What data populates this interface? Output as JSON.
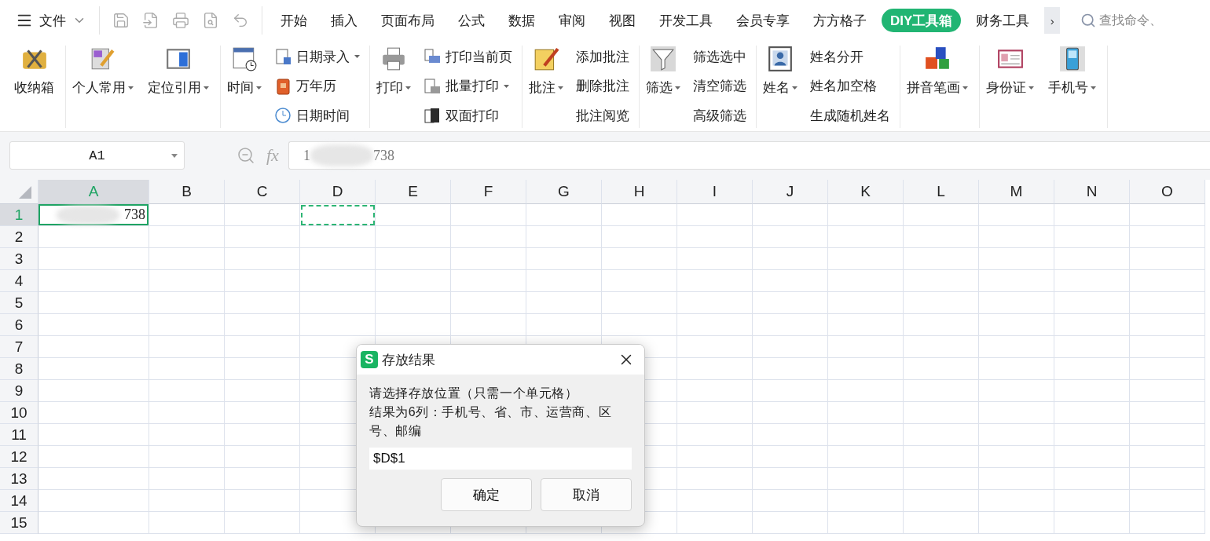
{
  "menu": {
    "file_label": "文件"
  },
  "tabs": [
    {
      "label": "开始",
      "selected": false
    },
    {
      "label": "插入",
      "selected": false
    },
    {
      "label": "页面布局",
      "selected": false
    },
    {
      "label": "公式",
      "selected": false
    },
    {
      "label": "数据",
      "selected": false
    },
    {
      "label": "审阅",
      "selected": false
    },
    {
      "label": "视图",
      "selected": false
    },
    {
      "label": "开发工具",
      "selected": false
    },
    {
      "label": "会员专享",
      "selected": false
    },
    {
      "label": "方方格子",
      "selected": false
    },
    {
      "label": "DIY工具箱",
      "selected": true
    },
    {
      "label": "财务工具",
      "selected": false
    }
  ],
  "more_tabs": "›",
  "search": {
    "placeholder": "查找命令、"
  },
  "ribbon": [
    {
      "items": [
        {
          "kind": "large",
          "label": "收纳箱",
          "dropdown": false
        }
      ]
    },
    {
      "items": [
        {
          "kind": "large",
          "label": "个人常用",
          "dropdown": true
        },
        {
          "kind": "large",
          "label": "定位引用",
          "dropdown": true
        }
      ]
    },
    {
      "items": [
        {
          "kind": "large",
          "label": "时间",
          "dropdown": true
        },
        {
          "kind": "stack",
          "entries": [
            {
              "label": "日期录入",
              "dropdown": true,
              "icon": true
            },
            {
              "label": "万年历",
              "dropdown": false,
              "icon": true
            },
            {
              "label": "日期时间",
              "dropdown": false,
              "icon": true
            }
          ]
        }
      ]
    },
    {
      "items": [
        {
          "kind": "large",
          "label": "打印",
          "dropdown": true
        },
        {
          "kind": "stack",
          "entries": [
            {
              "label": "打印当前页",
              "dropdown": false,
              "icon": true
            },
            {
              "label": "批量打印",
              "dropdown": true,
              "icon": true
            },
            {
              "label": "双面打印",
              "dropdown": false,
              "icon": true
            }
          ]
        }
      ]
    },
    {
      "items": [
        {
          "kind": "large",
          "label": "批注",
          "dropdown": true
        },
        {
          "kind": "stack",
          "entries": [
            {
              "label": "添加批注",
              "dropdown": false,
              "icon": false
            },
            {
              "label": "删除批注",
              "dropdown": false,
              "icon": false
            },
            {
              "label": "批注阅览",
              "dropdown": false,
              "icon": false
            }
          ]
        }
      ]
    },
    {
      "items": [
        {
          "kind": "large",
          "label": "筛选",
          "dropdown": true
        },
        {
          "kind": "stack",
          "entries": [
            {
              "label": "筛选选中",
              "dropdown": false,
              "icon": false
            },
            {
              "label": "清空筛选",
              "dropdown": false,
              "icon": false
            },
            {
              "label": "高级筛选",
              "dropdown": false,
              "icon": false
            }
          ]
        }
      ]
    },
    {
      "items": [
        {
          "kind": "large",
          "label": "姓名",
          "dropdown": true
        },
        {
          "kind": "stack",
          "entries": [
            {
              "label": "姓名分开",
              "dropdown": false,
              "icon": false
            },
            {
              "label": "姓名加空格",
              "dropdown": false,
              "icon": false
            },
            {
              "label": "生成随机姓名",
              "dropdown": false,
              "icon": false
            }
          ]
        }
      ]
    },
    {
      "items": [
        {
          "kind": "large",
          "label": "拼音笔画",
          "dropdown": true
        }
      ]
    },
    {
      "items": [
        {
          "kind": "large",
          "label": "身份证",
          "dropdown": true
        },
        {
          "kind": "large",
          "label": "手机号",
          "dropdown": true
        }
      ]
    }
  ],
  "name_box": {
    "value": "A1"
  },
  "formula": {
    "fx_label": "fx",
    "value_start": "1",
    "value_end": "738"
  },
  "grid": {
    "columns": [
      {
        "label": "A",
        "selected": true
      },
      {
        "label": "B",
        "selected": false
      },
      {
        "label": "C",
        "selected": false
      },
      {
        "label": "D",
        "selected": false
      },
      {
        "label": "E",
        "selected": false
      },
      {
        "label": "F",
        "selected": false
      },
      {
        "label": "G",
        "selected": false
      },
      {
        "label": "H",
        "selected": false
      },
      {
        "label": "I",
        "selected": false
      },
      {
        "label": "J",
        "selected": false
      },
      {
        "label": "K",
        "selected": false
      },
      {
        "label": "L",
        "selected": false
      },
      {
        "label": "M",
        "selected": false
      },
      {
        "label": "N",
        "selected": false
      },
      {
        "label": "O",
        "selected": false
      }
    ],
    "rows": [
      {
        "label": "1",
        "selected": true,
        "cells": [
          {
            "value": "738",
            "redacted": true,
            "active": true,
            "marquee": false
          },
          {
            "active": false,
            "marquee": false
          },
          {
            "active": false,
            "marquee": false
          },
          {
            "active": false,
            "marquee": true
          }
        ]
      },
      {
        "label": "2",
        "selected": false
      },
      {
        "label": "3",
        "selected": false
      },
      {
        "label": "4",
        "selected": false
      },
      {
        "label": "5",
        "selected": false
      },
      {
        "label": "6",
        "selected": false
      },
      {
        "label": "7",
        "selected": false
      },
      {
        "label": "8",
        "selected": false
      },
      {
        "label": "9",
        "selected": false
      },
      {
        "label": "10",
        "selected": false
      },
      {
        "label": "11",
        "selected": false
      },
      {
        "label": "12",
        "selected": false
      },
      {
        "label": "13",
        "selected": false
      },
      {
        "label": "14",
        "selected": false
      },
      {
        "label": "15",
        "selected": false
      }
    ]
  },
  "dialog": {
    "logo": "S",
    "title": "存放结果",
    "lines": [
      "请选择存放位置（只需一个单元格）",
      "结果为6列：手机号、省、市、运营商、区号、邮编"
    ],
    "input": "$D$1",
    "buttons": [
      "确定",
      "取消"
    ]
  }
}
